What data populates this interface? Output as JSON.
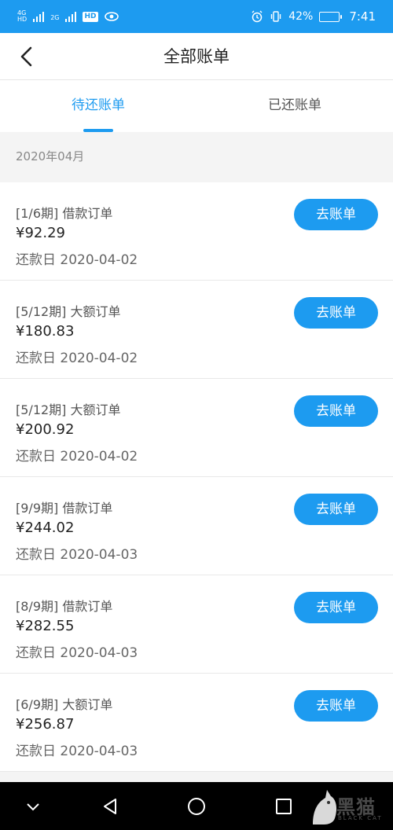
{
  "status_bar": {
    "network1_top": "4G",
    "network1_bottom": "HD",
    "network2_top": "2G",
    "hd_label": "HD",
    "battery_percent": "42%",
    "battery_level": 0.42,
    "time": "7:41",
    "icons": [
      "signal-icon",
      "signal-icon",
      "hd-icon",
      "eye-icon",
      "alarm-icon",
      "vibrate-icon",
      "battery-icon"
    ]
  },
  "header": {
    "title": "全部账单",
    "back_icon": "chevron-left-icon"
  },
  "tabs": [
    {
      "label": "待还账单",
      "active": true
    },
    {
      "label": "已还账单",
      "active": false
    }
  ],
  "month": "2020年04月",
  "bills": [
    {
      "title": "[1/6期] 借款订单",
      "amount": "¥92.29",
      "due": "还款日 2020-04-02",
      "button": "去账单"
    },
    {
      "title": "[5/12期] 大额订单",
      "amount": "¥180.83",
      "due": "还款日 2020-04-02",
      "button": "去账单"
    },
    {
      "title": "[5/12期] 大额订单",
      "amount": "¥200.92",
      "due": "还款日 2020-04-02",
      "button": "去账单"
    },
    {
      "title": "[9/9期] 借款订单",
      "amount": "¥244.02",
      "due": "还款日 2020-04-03",
      "button": "去账单"
    },
    {
      "title": "[8/9期] 借款订单",
      "amount": "¥282.55",
      "due": "还款日 2020-04-03",
      "button": "去账单"
    },
    {
      "title": "[6/9期] 大额订单",
      "amount": "¥256.87",
      "due": "还款日 2020-04-03",
      "button": "去账单"
    }
  ],
  "nav_bar": {
    "icons": [
      "chevron-down-icon",
      "back-triangle-icon",
      "home-circle-icon",
      "recents-square-icon"
    ]
  },
  "watermark": {
    "text": "黑猫",
    "sub": "BLACK CAT"
  },
  "colors": {
    "accent": "#1d9bf0",
    "background": "#f4f4f4",
    "nav": "#000000"
  }
}
